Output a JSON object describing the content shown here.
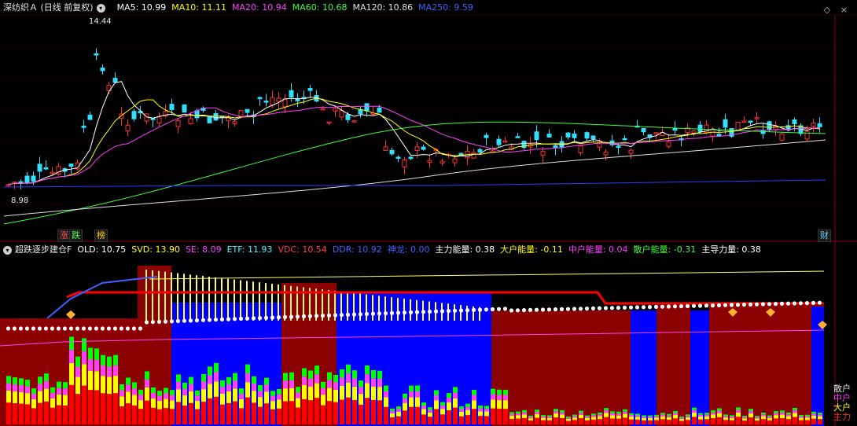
{
  "main": {
    "title": "深纺织Ａ (日线 前复权)",
    "ma_items": [
      {
        "label": "MA5: 10.99",
        "color": "#ffffff"
      },
      {
        "label": "MA10: 11.11",
        "color": "#ffff00"
      },
      {
        "label": "MA20: 10.94",
        "color": "#ff40ff"
      },
      {
        "label": "MA60: 10.68",
        "color": "#40ff40"
      },
      {
        "label": "MA120: 10.86",
        "color": "#e0e0e0"
      },
      {
        "label": "MA250: 9.59",
        "color": "#4060ff"
      }
    ],
    "high_label": "14.44",
    "low_label": "8.98",
    "badges": [
      {
        "text": "涨",
        "color": "#ff5050"
      },
      {
        "text": "跌",
        "color": "#50ff50"
      },
      {
        "text": "榜",
        "color": "#ffcc00"
      }
    ],
    "fin_badge": "财"
  },
  "indicator": {
    "title": "超跌逐步建仓F",
    "items": [
      {
        "label": "OLD: 10.75",
        "color": "#ffffff"
      },
      {
        "label": "SVD: 13.90",
        "color": "#ffff00"
      },
      {
        "label": "SE: 8.09",
        "color": "#ff40ff"
      },
      {
        "label": "ETF: 11.93",
        "color": "#40ffff"
      },
      {
        "label": "VDC: 10.54",
        "color": "#ff4040"
      },
      {
        "label": "DDR: 10.92",
        "color": "#4060ff"
      },
      {
        "label": "神龙: 0.00",
        "color": "#4060ff"
      },
      {
        "label": "主力能量: 0.38",
        "color": "#ffffff"
      },
      {
        "label": "大户能量: -0.11",
        "color": "#ffff00"
      },
      {
        "label": "中户能量: 0.04",
        "color": "#ff40ff"
      },
      {
        "label": "散户能量: -0.31",
        "color": "#40ff40"
      },
      {
        "label": "主导力量: 0.38",
        "color": "#ffffff"
      }
    ],
    "side_labels": [
      {
        "text": "散户",
        "color": "#e0e0e0"
      },
      {
        "text": "中户",
        "color": "#ff40ff"
      },
      {
        "text": "大户",
        "color": "#ffff00"
      },
      {
        "text": "主力",
        "color": "#ff3030"
      }
    ]
  }
}
